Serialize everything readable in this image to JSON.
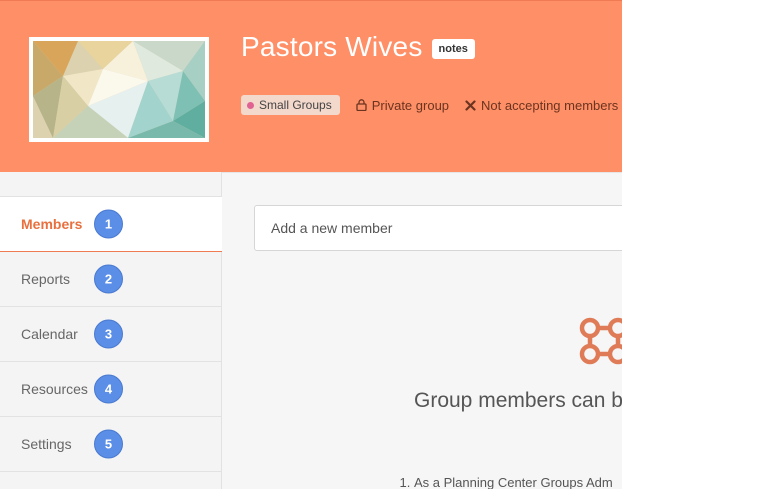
{
  "header": {
    "group_title": "Pastors Wives",
    "notes_badge": "notes",
    "tag_label": "Small Groups",
    "tag_color": "#e06292",
    "privacy_label": "Private group",
    "privacy_icon": "lock-icon",
    "enrollment_label": "Not accepting members",
    "enrollment_icon": "close-icon",
    "background_color": "#ff8f66"
  },
  "sidebar": {
    "items": [
      {
        "label": "Members",
        "badge": "1",
        "active": true
      },
      {
        "label": "Reports",
        "badge": "2"
      },
      {
        "label": "Calendar",
        "badge": "3"
      },
      {
        "label": "Resources",
        "badge": "4"
      },
      {
        "label": "Settings",
        "badge": "5"
      }
    ],
    "accent_color": "#e8703f",
    "badge_color": "#5b8ee6"
  },
  "main": {
    "add_member_placeholder": "Add a new member",
    "empty_heading": "Group members can be ways:",
    "empty_icon": "groups-icon",
    "empty_list_item": "As a Planning Center Groups Adm"
  }
}
